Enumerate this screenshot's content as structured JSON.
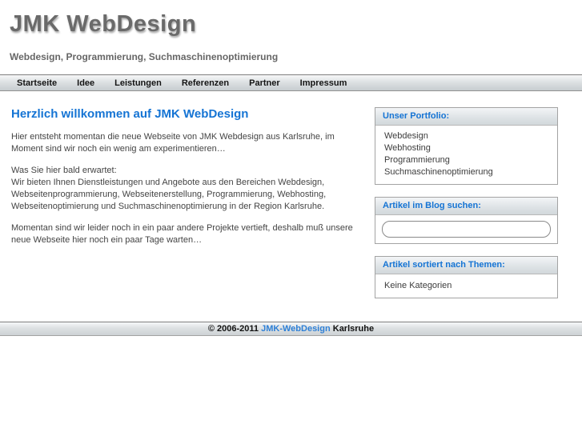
{
  "header": {
    "title": "JMK WebDesign",
    "tagline": "Webdesign, Programmierung, Suchmaschinenoptimierung"
  },
  "nav": {
    "items": [
      "Startseite",
      "Idee",
      "Leistungen",
      "Referenzen",
      "Partner",
      "Impressum"
    ]
  },
  "main": {
    "heading": "Herzlich willkommen auf JMK WebDesign",
    "intro": "Hier entsteht momentan die neue Webseite von JMK Webdesign aus Karlsruhe, im Moment sind wir noch ein wenig am experimentieren…",
    "expect_label": "Was Sie hier bald erwartet:",
    "services": "Wir bieten Ihnen Dienstleistungen und Angebote aus den Bereichen Webdesign, Webseitenprogrammierung, Webseitenerstellung, Programmierung, Webhosting, Webseitenoptimierung und Suchmaschinenoptimierung in der Region Karlsruhe.",
    "outro": "Momentan sind wir leider noch in ein paar andere Projekte vertieft, deshalb muß unsere neue Webseite hier noch ein paar Tage warten…"
  },
  "sidebar": {
    "portfolio": {
      "title": "Unser Portfolio:",
      "items": [
        "Webdesign",
        "Webhosting",
        "Programmierung",
        "Suchmaschinenoptimierung"
      ]
    },
    "search": {
      "title": "Artikel im Blog suchen:",
      "value": "",
      "placeholder": ""
    },
    "categories": {
      "title": "Artikel sortiert nach Themen:",
      "empty_label": "Keine Kategorien"
    }
  },
  "footer": {
    "prefix": "© 2006-2011 ",
    "link_label": "JMK-WebDesign",
    "suffix": " Karlsruhe"
  },
  "colors": {
    "accent_blue": "#1574d4",
    "footer_link_blue": "#2d7fd6",
    "title_gray": "#6a6a6a",
    "body_text": "#444444"
  }
}
